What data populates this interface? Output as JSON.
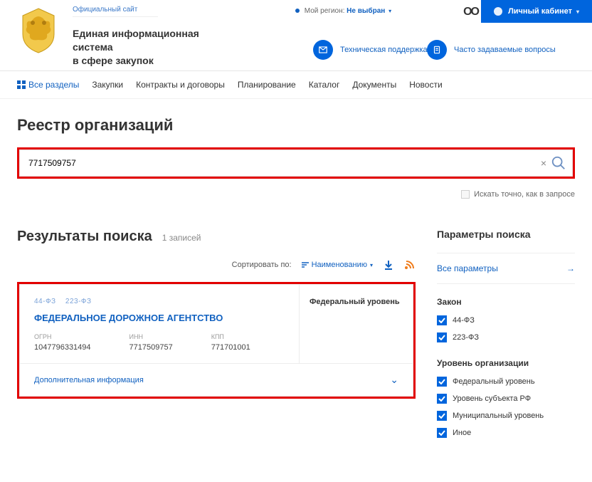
{
  "header": {
    "official": "Официальный сайт",
    "title1": "Единая информационная система",
    "title2": "в сфере закупок",
    "region_label": "Мой регион:",
    "region_value": "Не выбран",
    "eyes_glyph": "OO",
    "cabinet": "Личный кабинет",
    "support": "Техническая поддержка",
    "faq": "Часто задаваемые вопросы"
  },
  "nav": {
    "all": "Все разделы",
    "items": [
      "Закупки",
      "Контракты и договоры",
      "Планирование",
      "Каталог",
      "Документы",
      "Новости"
    ]
  },
  "page": {
    "title": "Реестр организаций",
    "search_value": "7717509757",
    "clear_glyph": "×",
    "exact": "Искать точно, как в запросе"
  },
  "results": {
    "title": "Результаты поиска",
    "count": "1 записей",
    "sort_label": "Сортировать по:",
    "sort_value": "Наименованию",
    "rss_glyph": "⌁"
  },
  "card": {
    "tag1": "44-ФЗ",
    "tag2": "223-ФЗ",
    "name": "ФЕДЕРАЛЬНОЕ ДОРОЖНОЕ АГЕНТСТВО",
    "level": "Федеральный уровень",
    "ogrn_k": "ОГРН",
    "ogrn_v": "1047796331494",
    "inn_k": "ИНН",
    "inn_v": "7717509757",
    "kpp_k": "КПП",
    "kpp_v": "771701001",
    "more": "Дополнительная информация"
  },
  "filters": {
    "title": "Параметры поиска",
    "all": "Все параметры",
    "law_title": "Закон",
    "law": [
      "44-ФЗ",
      "223-ФЗ"
    ],
    "level_title": "Уровень организации",
    "levels": [
      "Федеральный уровень",
      "Уровень субъекта РФ",
      "Муниципальный уровень",
      "Иное"
    ]
  }
}
